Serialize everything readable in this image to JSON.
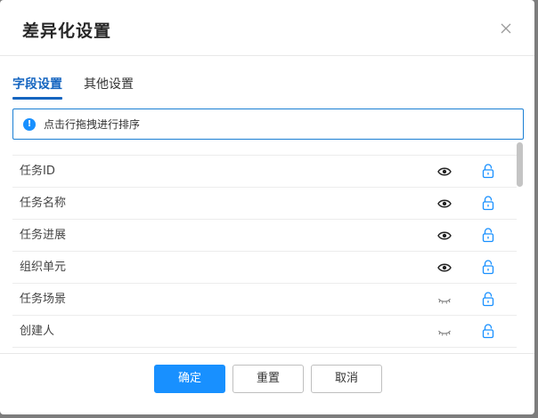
{
  "dialog": {
    "title": "差异化设置"
  },
  "tabs": [
    {
      "label": "字段设置",
      "active": true
    },
    {
      "label": "其他设置",
      "active": false
    }
  ],
  "notice": {
    "icon": "info-icon",
    "text": "点击行拖拽进行排序"
  },
  "fields": [
    {
      "label": "任务ID",
      "visible": true
    },
    {
      "label": "任务名称",
      "visible": true
    },
    {
      "label": "任务进展",
      "visible": true
    },
    {
      "label": "组织单元",
      "visible": true
    },
    {
      "label": "任务场景",
      "visible": false
    },
    {
      "label": "创建人",
      "visible": false
    }
  ],
  "footer": {
    "confirm_label": "确定",
    "reset_label": "重置",
    "cancel_label": "取消"
  },
  "colors": {
    "accent": "#1890ff",
    "tab_active": "#1565c0"
  }
}
